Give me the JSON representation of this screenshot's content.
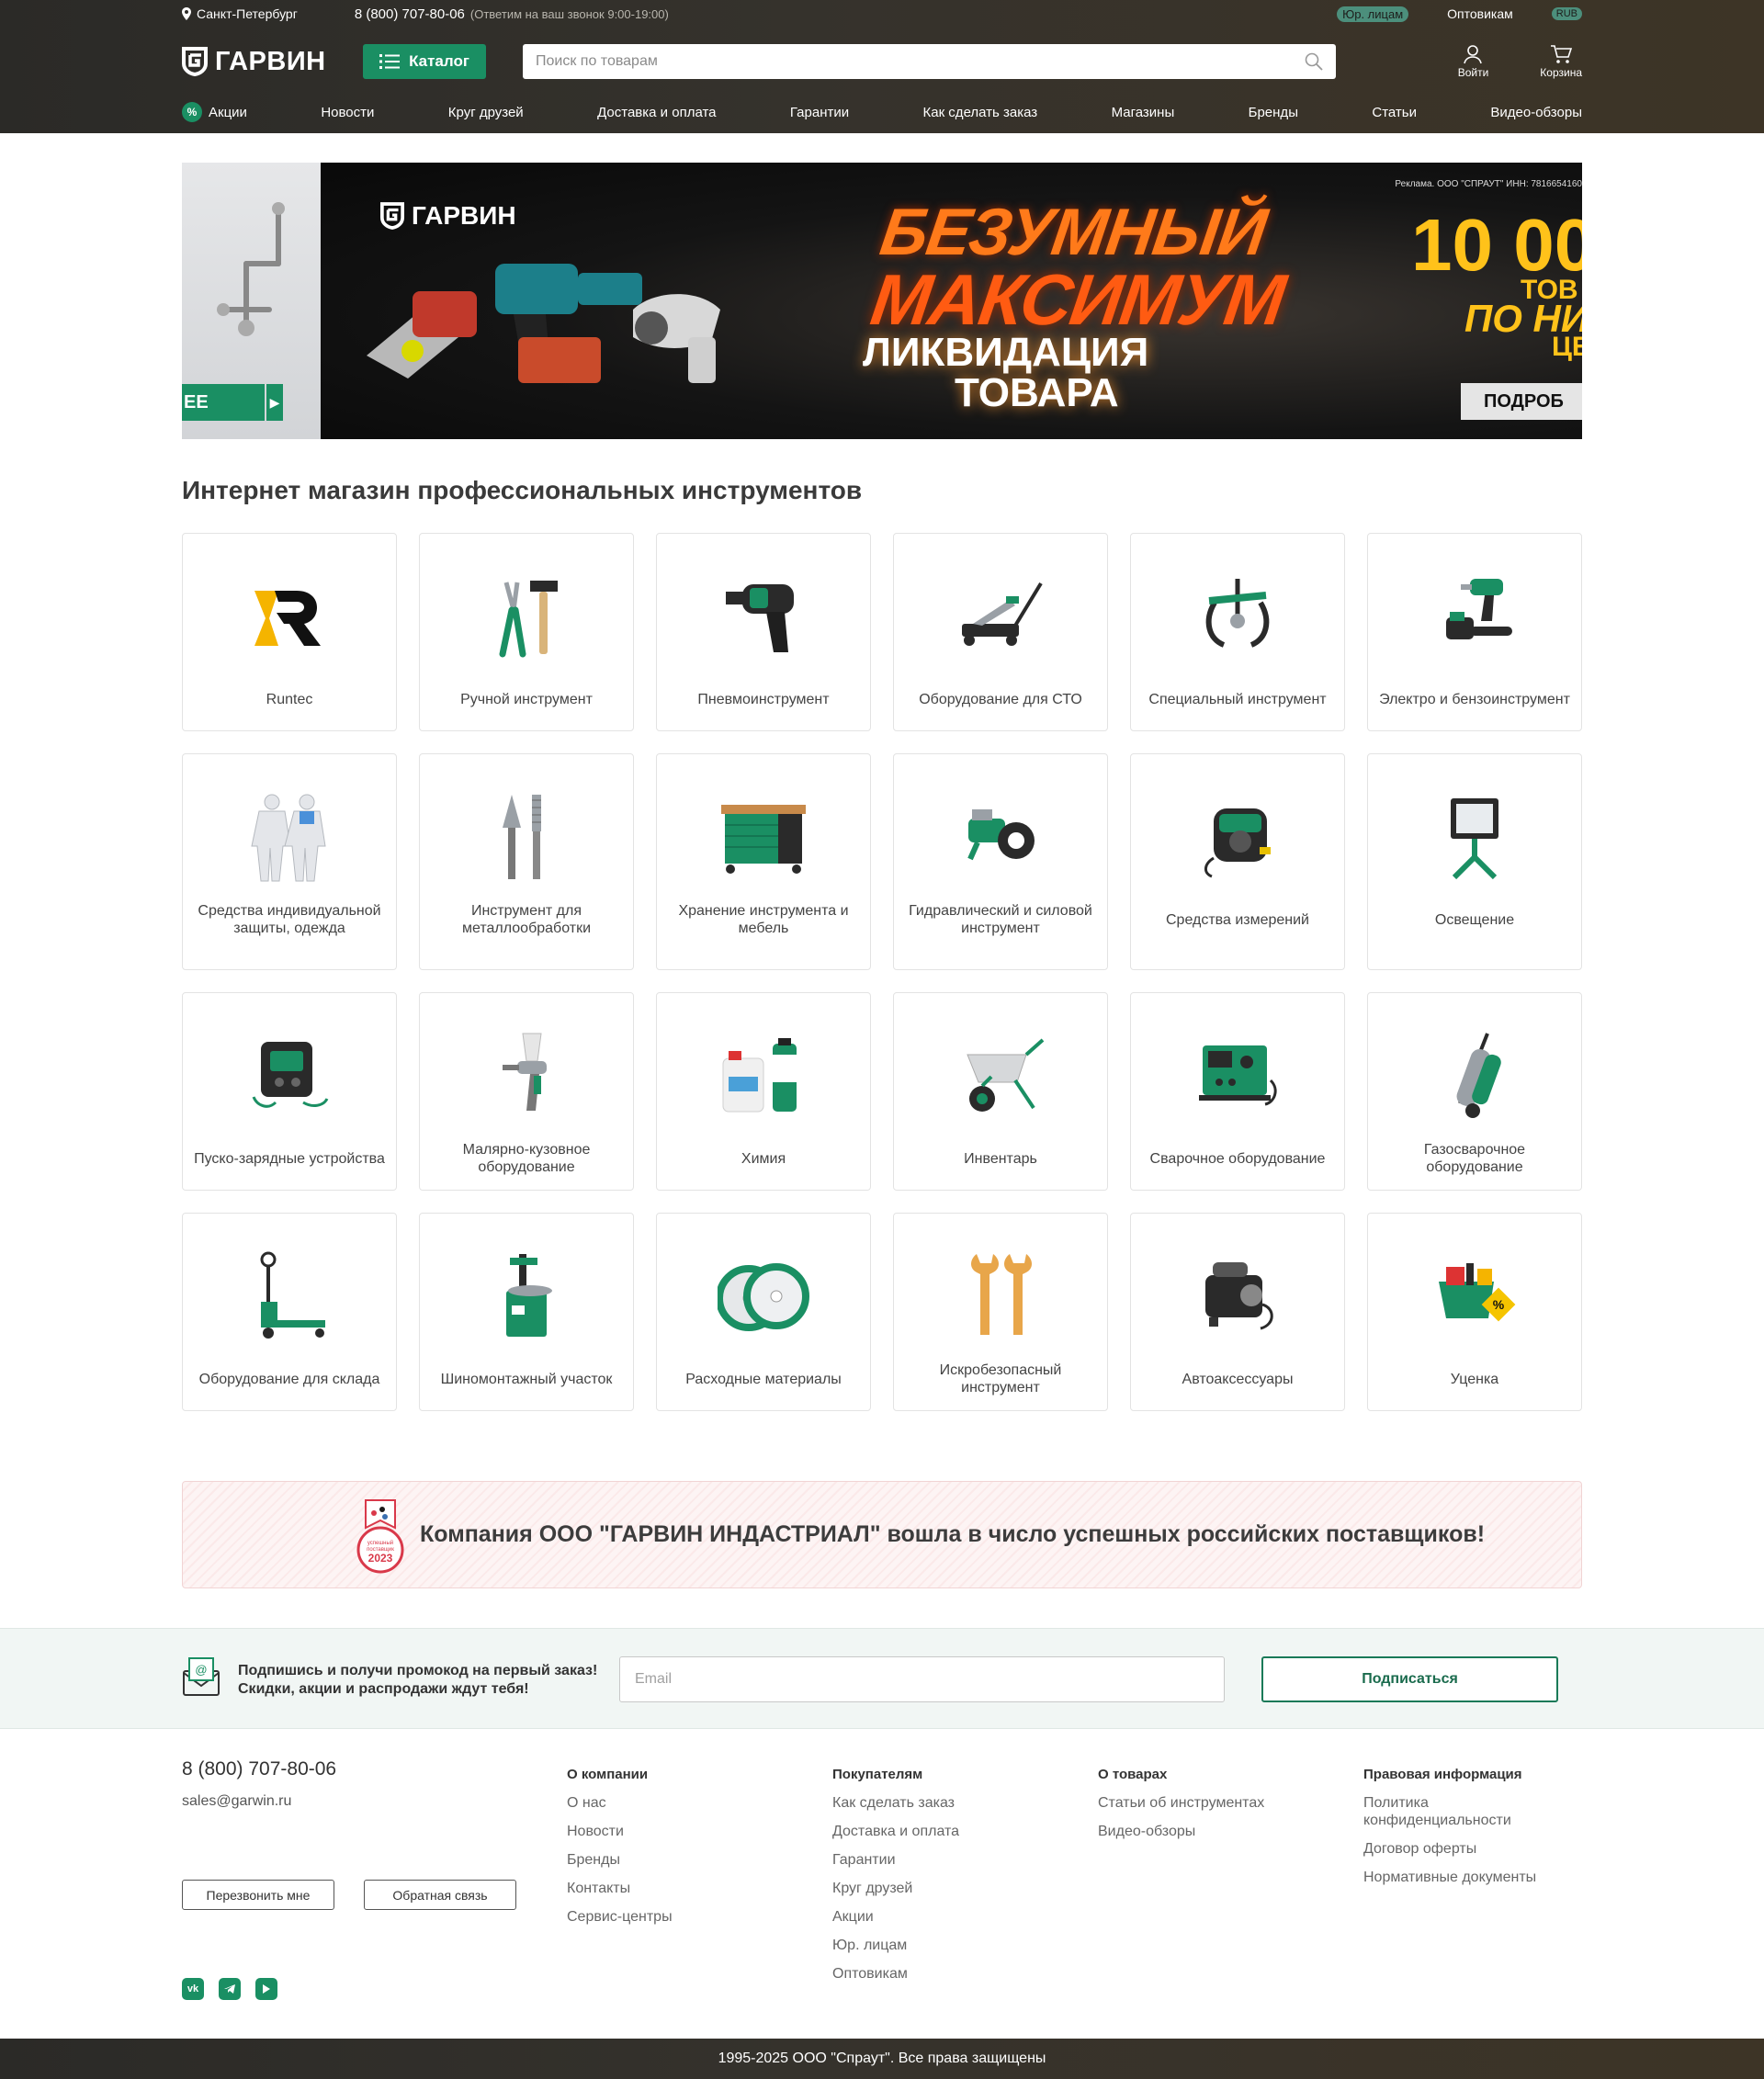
{
  "header": {
    "city": "Санкт-Петербург",
    "phone": "8 (800) 707-80-06",
    "phone_note": "(Ответим на ваш звонок 9:00-19:00)",
    "legal_label": "Юр. лицам",
    "wholesale_label": "Оптовикам",
    "currency": "RUB",
    "logo_text": "ГАРВИН",
    "catalog_label": "Каталог",
    "search_placeholder": "Поиск по товарам",
    "login_label": "Войти",
    "cart_label": "Корзина",
    "nav": [
      "Акции",
      "Новости",
      "Круг друзей",
      "Доставка и оплата",
      "Гарантии",
      "Как сделать заказ",
      "Магазины",
      "Бренды",
      "Статьи",
      "Видео-обзоры"
    ],
    "colors": {
      "accent": "#1a8f63",
      "header_bg": "#2f2d28"
    }
  },
  "banner": {
    "side_button": "ЕЕ",
    "logo_text": "ГАРВИН",
    "line1": "БЕЗУМНЫЙ",
    "line2": "МАКСИМУМ",
    "line3": "ЛИКВИДАЦИЯ",
    "line4": "ТОВАРА",
    "disclaimer": "Реклама. ООО \"СПРАУТ\" ИНН: 7816654160",
    "number": "10 00",
    "word1": "ТОВ",
    "word2": "ПО НИЗ",
    "word3": "ЦЕ",
    "button": "ПОДРОБ"
  },
  "main": {
    "title": "Интернет магазин профессиональных инструментов",
    "categories": [
      {
        "label": "Runtec",
        "icon": "runtec-logo"
      },
      {
        "label": "Ручной инструмент",
        "icon": "pliers-hammer-icon"
      },
      {
        "label": "Пневмоинструмент",
        "icon": "impact-wrench-icon"
      },
      {
        "label": "Оборудование для СТО",
        "icon": "floor-jack-icon"
      },
      {
        "label": "Специальный инструмент",
        "icon": "puller-icon"
      },
      {
        "label": "Электро и бензоинструмент",
        "icon": "drill-chainsaw-icon"
      },
      {
        "label": "Средства индивидуальной защиты, одежда",
        "icon": "coverall-icon"
      },
      {
        "label": "Инструмент для металлообработки",
        "icon": "cutter-bits-icon"
      },
      {
        "label": "Хранение инструмента и мебель",
        "icon": "workbench-icon"
      },
      {
        "label": "Гидравлический и силовой инструмент",
        "icon": "hydraulic-wrench-icon"
      },
      {
        "label": "Средства измерений",
        "icon": "tape-measure-icon"
      },
      {
        "label": "Освещение",
        "icon": "floodlight-icon"
      },
      {
        "label": "Пуско-зарядные устройства",
        "icon": "jump-starter-icon"
      },
      {
        "label": "Малярно-кузовное оборудование",
        "icon": "spray-gun-icon"
      },
      {
        "label": "Химия",
        "icon": "chemicals-icon"
      },
      {
        "label": "Инвентарь",
        "icon": "wheelbarrow-icon"
      },
      {
        "label": "Сварочное оборудование",
        "icon": "welder-icon"
      },
      {
        "label": "Газосварочное оборудование",
        "icon": "gas-cylinder-cart-icon"
      },
      {
        "label": "Оборудование для склада",
        "icon": "pallet-jack-icon"
      },
      {
        "label": "Шиномонтажный участок",
        "icon": "tire-changer-icon"
      },
      {
        "label": "Расходные материалы",
        "icon": "cutting-discs-icon"
      },
      {
        "label": "Искробезопасный инструмент",
        "icon": "spark-free-wrench-icon"
      },
      {
        "label": "Автоаксессуары",
        "icon": "compressor-icon"
      },
      {
        "label": "Уценка",
        "icon": "discount-tools-icon"
      }
    ]
  },
  "badge": {
    "text": "Компания ООО \"ГАРВИН ИНДАСТРИАЛ\" вошла в число успешных российских поставщиков!",
    "medal_text": "успешный поставщик",
    "medal_year": "2023"
  },
  "subscribe": {
    "line1": "Подпишись и получи промокод на первый заказ!",
    "line2": "Скидки, акции и распродажи ждут тебя!",
    "email_placeholder": "Email",
    "button": "Подписаться"
  },
  "footer": {
    "phone": "8 (800) 707-80-06",
    "email": "sales@garwin.ru",
    "callback_button": "Перезвонить мне",
    "feedback_button": "Обратная связь",
    "columns": [
      {
        "title": "О компании",
        "items": [
          "О нас",
          "Новости",
          "Бренды",
          "Контакты",
          "Сервис-центры"
        ]
      },
      {
        "title": "Покупателям",
        "items": [
          "Как сделать заказ",
          "Доставка и оплата",
          "Гарантии",
          "Круг друзей",
          "Акции",
          "Юр. лицам",
          "Оптовикам"
        ]
      },
      {
        "title": "О товарах",
        "items": [
          "Статьи об инструментах",
          "Видео-обзоры"
        ]
      },
      {
        "title": "Правовая информация",
        "items": [
          "Политика конфиденциальности",
          "Договор оферты",
          "Нормативные документы"
        ]
      }
    ],
    "socials": [
      "vk-icon",
      "telegram-icon",
      "youtube-icon"
    ],
    "copyright": "1995-2025 ООО \"Спраут\". Все права защищены"
  }
}
